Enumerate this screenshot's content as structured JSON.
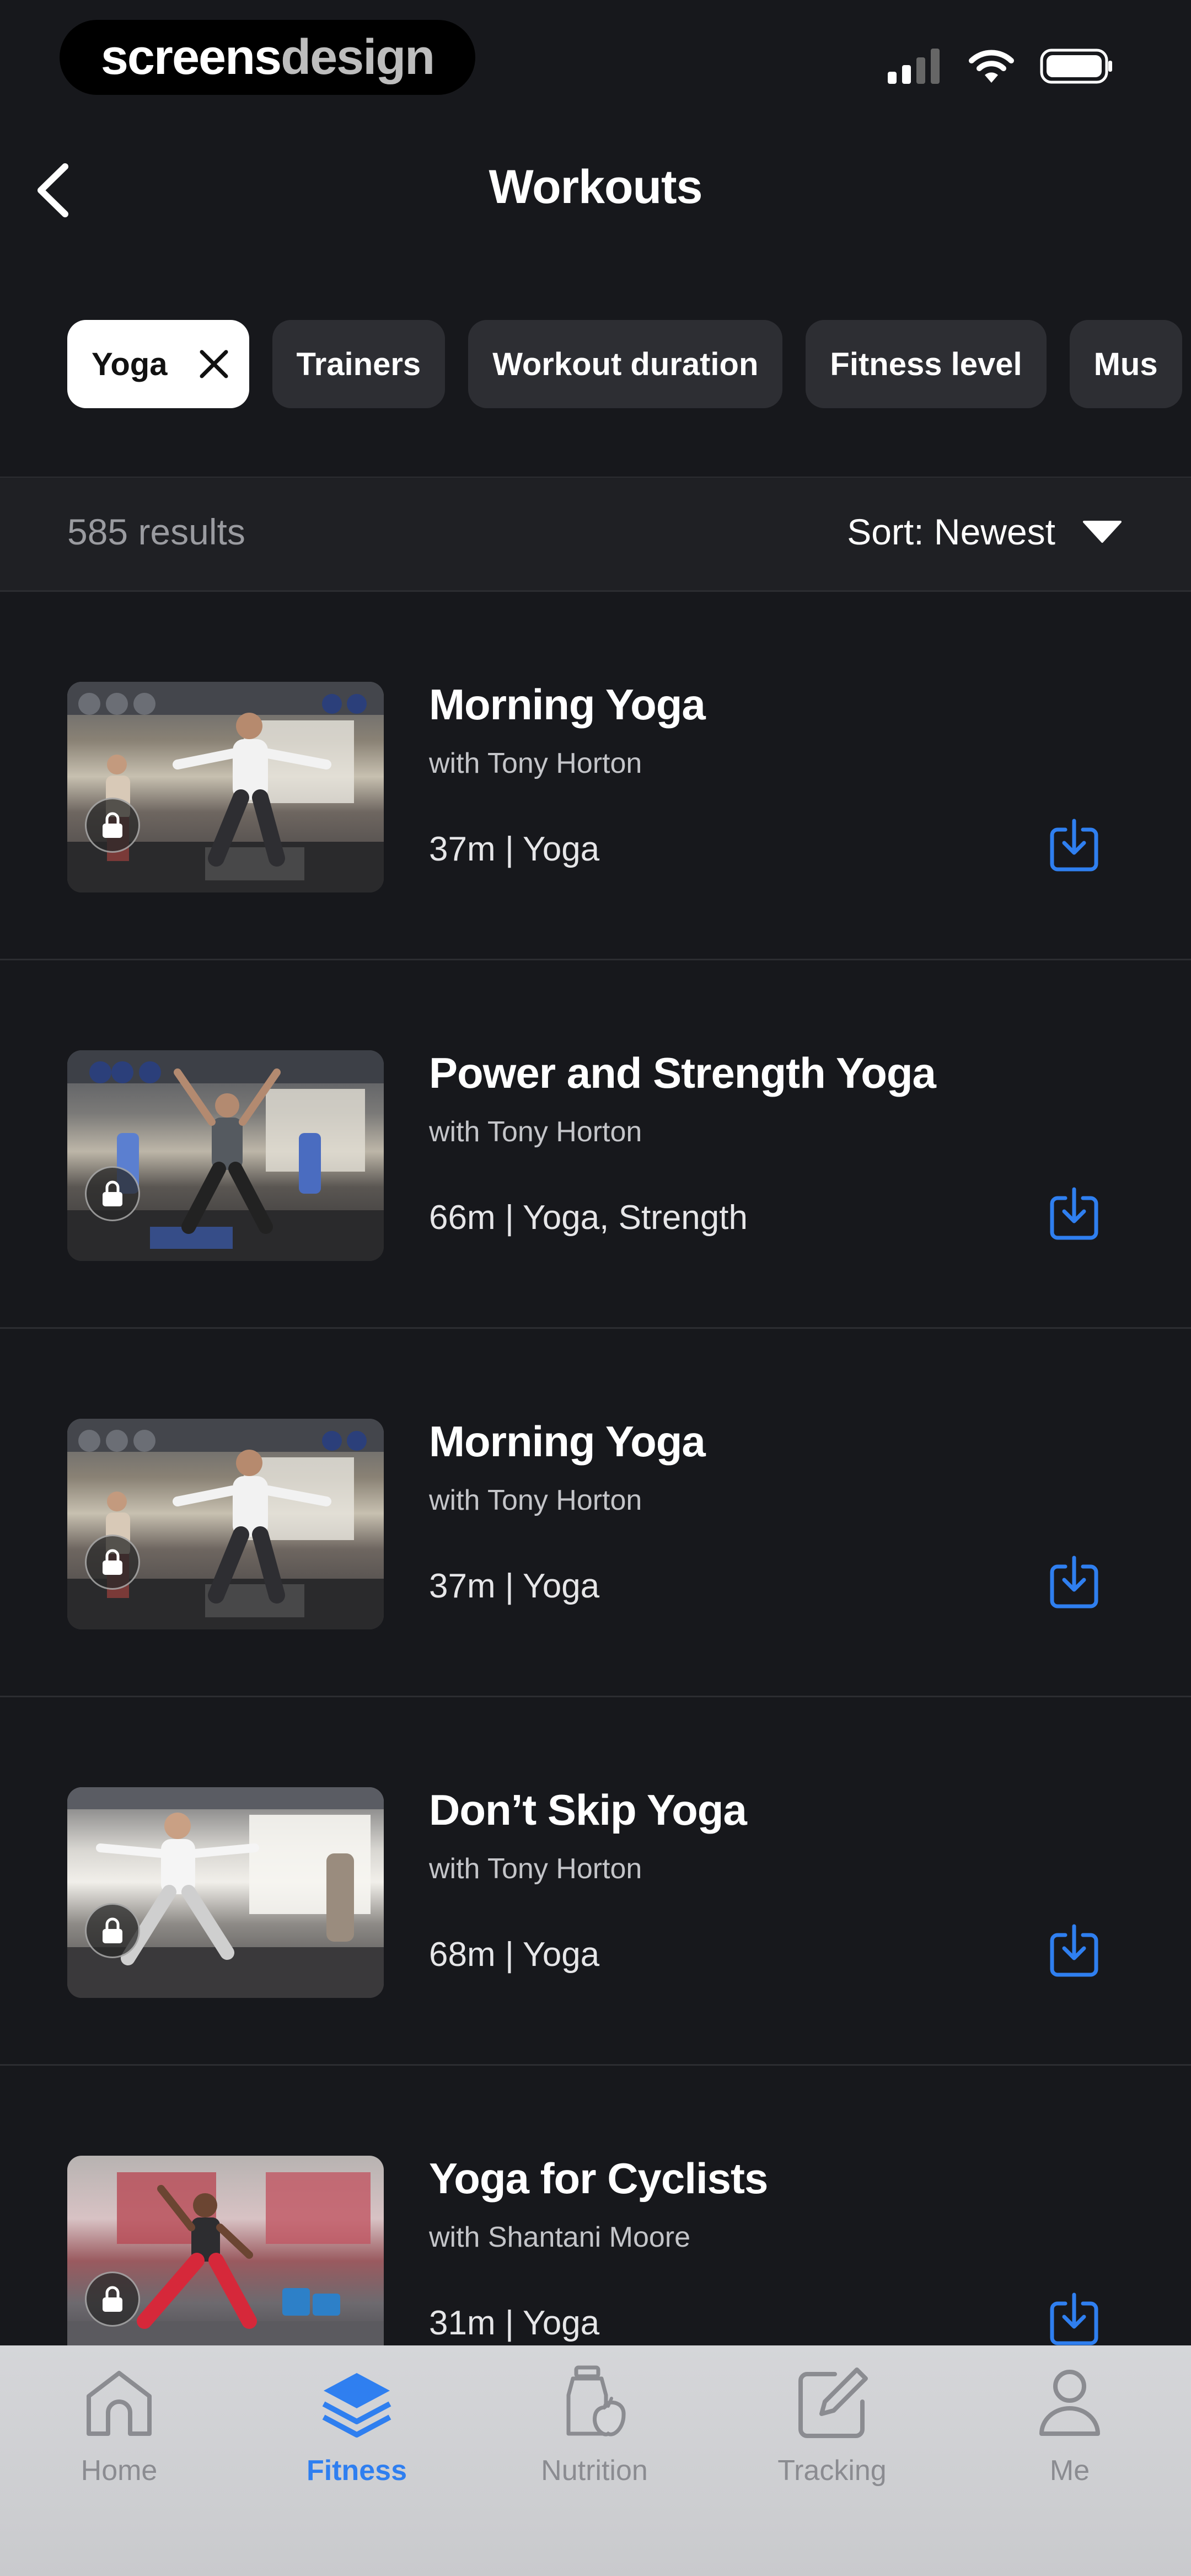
{
  "status_bar": {
    "logo_part1": "screens",
    "logo_part2": "design"
  },
  "header": {
    "title": "Workouts"
  },
  "filters": {
    "chips": [
      "Yoga",
      "Trainers",
      "Workout duration",
      "Fitness level",
      "Mus"
    ]
  },
  "results": {
    "count": "585 results",
    "sort": "Sort: Newest"
  },
  "workouts": [
    {
      "title": "Morning Yoga",
      "trainer": "with Tony Horton",
      "meta": "37m | Yoga"
    },
    {
      "title": "Power and Strength Yoga",
      "trainer": "with Tony Horton",
      "meta": "66m | Yoga, Strength"
    },
    {
      "title": "Morning Yoga",
      "trainer": "with Tony Horton",
      "meta": "37m | Yoga"
    },
    {
      "title": "Don’t Skip Yoga",
      "trainer": "with Tony Horton",
      "meta": "68m | Yoga"
    },
    {
      "title": "Yoga for Cyclists",
      "trainer": "with Shantani Moore",
      "meta": "31m | Yoga"
    }
  ],
  "tabbar": {
    "tabs": [
      {
        "label": "Home",
        "icon": "home-icon"
      },
      {
        "label": "Fitness",
        "icon": "layers-icon"
      },
      {
        "label": "Nutrition",
        "icon": "nutrition-icon"
      },
      {
        "label": "Tracking",
        "icon": "tracking-icon"
      },
      {
        "label": "Me",
        "icon": "person-icon"
      }
    ],
    "active": "Fitness"
  },
  "colors": {
    "accent": "#2f7ff0",
    "background": "#17181c",
    "chip": "#2d2e33"
  }
}
